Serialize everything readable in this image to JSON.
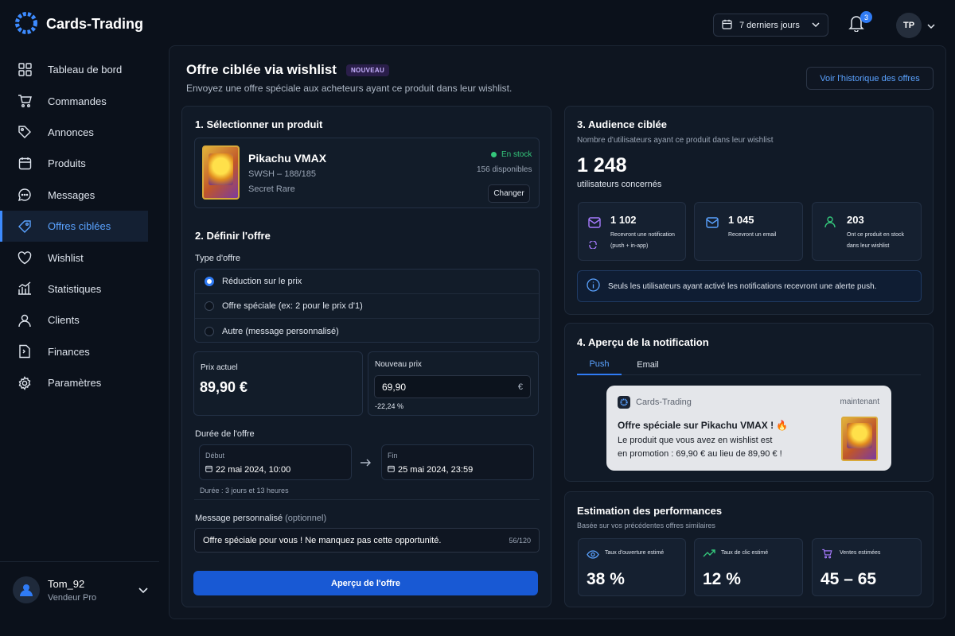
{
  "brand": {
    "name": "Cards-Trading"
  },
  "nav": [
    {
      "label": "Tableau de bord",
      "icon": "dashboard-icon"
    },
    {
      "label": "Commandes",
      "icon": "cart-icon"
    },
    {
      "label": "Annonces",
      "icon": "tag-icon"
    },
    {
      "label": "Produits",
      "icon": "calendar-icon"
    },
    {
      "label": "Messages",
      "icon": "chat-icon"
    },
    {
      "label": "Offres ciblées",
      "icon": "offer-tag-icon",
      "active": true
    },
    {
      "label": "Wishlist",
      "icon": "heart-icon"
    },
    {
      "label": "Statistiques",
      "icon": "chart-icon"
    },
    {
      "label": "Clients",
      "icon": "person-icon"
    },
    {
      "label": "Finances",
      "icon": "document-icon"
    },
    {
      "label": "Paramètres",
      "icon": "gear-icon"
    }
  ],
  "user": {
    "name": "Tom_92",
    "role": "Vendeur Pro"
  },
  "topbar": {
    "date_range": "7 derniers jours",
    "notif_count": "3",
    "avatar_initials": "TP"
  },
  "page": {
    "title": "Offre ciblée via wishlist",
    "badge": "NOUVEAU",
    "subtitle": "Envoyez une offre spéciale aux acheteurs ayant ce produit dans leur wishlist.",
    "history_button": "Voir l'historique des offres"
  },
  "step1": {
    "title": "1. Sélectionner un produit",
    "product_name": "Pikachu VMAX",
    "product_set": "SWSH – 188/185",
    "product_rarity": "Secret Rare",
    "stock_status": "En stock",
    "stock_count": "156 disponibles",
    "change_button": "Changer"
  },
  "step2": {
    "title": "2. Définir l'offre",
    "type_label": "Type d'offre",
    "options": [
      {
        "label": "Réduction sur le prix",
        "selected": true
      },
      {
        "label": "Offre spéciale (ex: 2 pour le prix d'1)",
        "selected": false
      },
      {
        "label": "Autre (message personnalisé)",
        "selected": false
      }
    ],
    "current_price_label": "Prix actuel",
    "current_price": "89,90 €",
    "new_price_label": "Nouveau prix",
    "new_price": "69,90",
    "currency": "€",
    "discount": "-22,24 %",
    "duration_label": "Durée de l'offre",
    "start_label": "Début",
    "start_value": "22 mai 2024, 10:00",
    "end_label": "Fin",
    "end_value": "25 mai 2024, 23:59",
    "duration_text": "Durée : 3 jours et 13 heures",
    "message_label": "Message personnalisé",
    "message_optional": "(optionnel)",
    "message_value": "Offre spéciale pour vous ! Ne manquez pas cette opportunité.",
    "message_count": "56/120",
    "preview_button": "Aperçu de l'offre"
  },
  "step3": {
    "title": "3. Audience ciblée",
    "subtitle": "Nombre d'utilisateurs ayant ce produit dans leur wishlist",
    "total": "1 248",
    "total_label": "utilisateurs concernés",
    "stats": [
      {
        "value": "1 102",
        "label1": "Recevront une notification",
        "label2": "(push + in-app)"
      },
      {
        "value": "1 045",
        "label1": "Recevront un email",
        "label2": ""
      },
      {
        "value": "203",
        "label1": "Ont ce produit en stock",
        "label2": "dans leur wishlist"
      }
    ],
    "info": "Seuls les utilisateurs ayant activé les notifications recevront une alerte push."
  },
  "step4": {
    "title": "4. Aperçu de la notification",
    "tabs": [
      "Push",
      "Email"
    ],
    "notif_app": "Cards-Trading",
    "notif_time": "maintenant",
    "notif_title": "Offre spéciale sur Pikachu VMAX ! 🔥",
    "notif_line1": "Le produit que vous avez en wishlist est",
    "notif_line2": "en promotion : 69,90 € au lieu de 89,90 € !"
  },
  "perf": {
    "title": "Estimation des performances",
    "subtitle": "Basée sur vos précédentes offres similaires",
    "metrics": [
      {
        "label": "Taux d'ouverture estimé",
        "value": "38 %"
      },
      {
        "label": "Taux de clic estimé",
        "value": "12 %"
      },
      {
        "label": "Ventes estimées",
        "value": "45 – 65"
      }
    ]
  },
  "colors": {
    "accent": "#2f7bf5",
    "success": "#34c77b",
    "purple": "#a77bff"
  }
}
